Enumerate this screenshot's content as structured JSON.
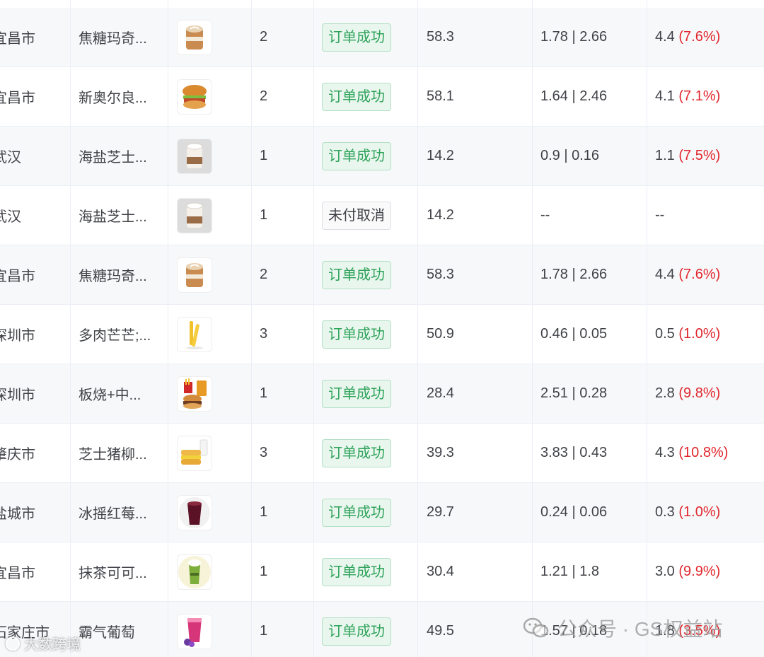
{
  "rows": [
    {
      "city": "宜昌市",
      "product": "焦糖玛奇...",
      "image": "latte-art-cup-icon",
      "qty": "2",
      "status": "订单成功",
      "status_type": "success",
      "amount": "58.3",
      "commission": "1.78 | 2.66",
      "total": "4.4",
      "pct": "(7.6%)"
    },
    {
      "city": "宜昌市",
      "product": "新奥尔良...",
      "image": "chicken-burger-icon",
      "qty": "2",
      "status": "订单成功",
      "status_type": "success",
      "amount": "58.1",
      "commission": "1.64 | 2.46",
      "total": "4.1",
      "pct": "(7.1%)"
    },
    {
      "city": "武汉",
      "product": "海盐芝士...",
      "image": "sea-salt-latte-icon",
      "qty": "1",
      "status": "订单成功",
      "status_type": "success",
      "amount": "14.2",
      "commission": "0.9 | 0.16",
      "total": "1.1",
      "pct": "(7.5%)"
    },
    {
      "city": "武汉",
      "product": "海盐芝士...",
      "image": "sea-salt-latte-icon",
      "qty": "1",
      "status": "未付取消",
      "status_type": "cancel",
      "amount": "14.2",
      "commission": "--",
      "total": "--",
      "pct": ""
    },
    {
      "city": "宜昌市",
      "product": "焦糖玛奇...",
      "image": "latte-art-cup-icon",
      "qty": "2",
      "status": "订单成功",
      "status_type": "success",
      "amount": "58.3",
      "commission": "1.78 | 2.66",
      "total": "4.4",
      "pct": "(7.6%)"
    },
    {
      "city": "深圳市",
      "product": "多肉芒芒;...",
      "image": "fries-icon",
      "qty": "3",
      "status": "订单成功",
      "status_type": "success",
      "amount": "50.9",
      "commission": "0.46 | 0.05",
      "total": "0.5",
      "pct": "(1.0%)"
    },
    {
      "city": "深圳市",
      "product": "板烧+中...",
      "image": "burger-combo-icon",
      "qty": "1",
      "status": "订单成功",
      "status_type": "success",
      "amount": "28.4",
      "commission": "2.51 | 0.28",
      "total": "2.8",
      "pct": "(9.8%)"
    },
    {
      "city": "肇庆市",
      "product": "芝士猪柳...",
      "image": "breakfast-sandwich-icon",
      "qty": "3",
      "status": "订单成功",
      "status_type": "success",
      "amount": "39.3",
      "commission": "3.83 | 0.43",
      "total": "4.3",
      "pct": "(10.8%)"
    },
    {
      "city": "盐城市",
      "product": "冰摇红莓...",
      "image": "berry-drink-icon",
      "qty": "1",
      "status": "订单成功",
      "status_type": "success",
      "amount": "29.7",
      "commission": "0.24 | 0.06",
      "total": "0.3",
      "pct": "(1.0%)"
    },
    {
      "city": "宜昌市",
      "product": "抹茶可可...",
      "image": "matcha-drink-icon",
      "qty": "1",
      "status": "订单成功",
      "status_type": "success",
      "amount": "30.4",
      "commission": "1.21 | 1.8",
      "total": "3.0",
      "pct": "(9.9%)"
    },
    {
      "city": "石家庄市",
      "product": "霸气葡萄",
      "image": "grape-tea-icon",
      "qty": "1",
      "status": "订单成功",
      "status_type": "success",
      "amount": "49.5",
      "commission": "1.57 | 0.18",
      "total": "1.8",
      "pct": "(3.5%)"
    }
  ],
  "watermarks": {
    "left": "大数跨境",
    "right": "公众号 · GS权益站"
  },
  "colors": {
    "success_text": "#2fa35a",
    "success_bg": "#e8f6ee",
    "percent_red": "#e0262c",
    "row_stripe": "#f7f8fa"
  }
}
